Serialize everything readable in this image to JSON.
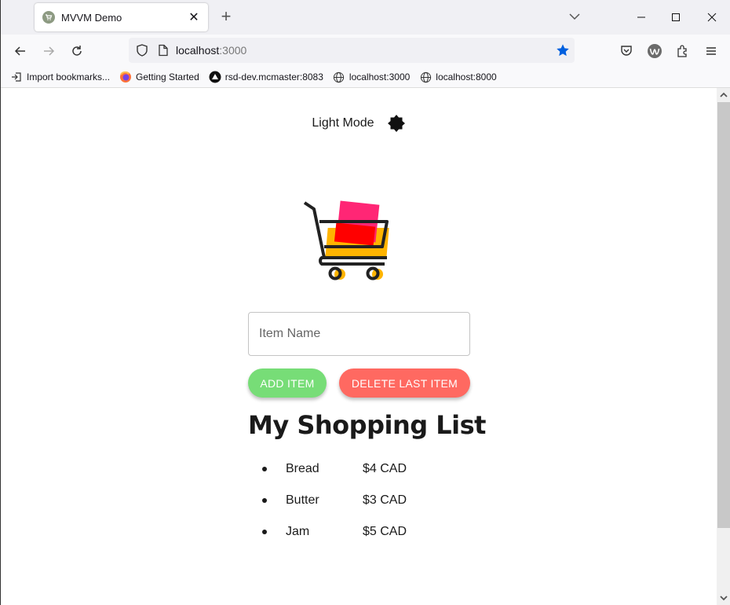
{
  "browser": {
    "tab": {
      "title": "MVVM Demo",
      "favicon": "cart-favicon"
    },
    "url": {
      "host": "localhost",
      "port": ":3000"
    },
    "bookmarks": [
      {
        "label": "Import bookmarks...",
        "icon": "import-icon"
      },
      {
        "label": "Getting Started",
        "icon": "firefox-icon"
      },
      {
        "label": "rsd-dev.mcmaster:8083",
        "icon": "triangle-logo-icon"
      },
      {
        "label": "localhost:3000",
        "icon": "globe-icon"
      },
      {
        "label": "localhost:8000",
        "icon": "globe-icon"
      }
    ],
    "accent_color": "#0060df"
  },
  "app": {
    "mode_label": "Light Mode",
    "mode_icon": "brightness-icon",
    "input": {
      "placeholder": "Item Name",
      "value": ""
    },
    "buttons": {
      "add": "ADD ITEM",
      "delete": "DELETE LAST ITEM"
    },
    "colors": {
      "add": "#77dd77",
      "delete": "#ff6961"
    },
    "list_title": "My Shopping List",
    "items": [
      {
        "name": "Bread",
        "price": "$4 CAD"
      },
      {
        "name": "Butter",
        "price": "$3 CAD"
      },
      {
        "name": "Jam",
        "price": "$5 CAD"
      }
    ]
  }
}
